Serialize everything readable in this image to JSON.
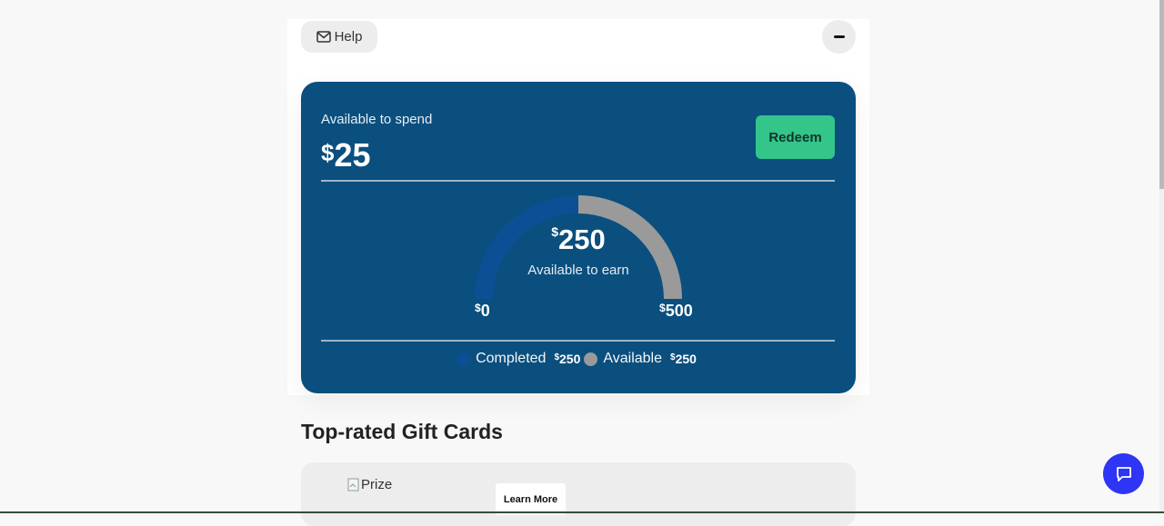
{
  "header": {
    "help_label": "Help",
    "help_icon": "mail-icon",
    "collapse_icon": "minus-icon"
  },
  "rewards": {
    "spend_label": "Available to spend",
    "currency": "$",
    "spend_amount": "25",
    "redeem_label": "Redeem",
    "earn_amount": "250",
    "earn_label": "Available to earn",
    "scale_min": "0",
    "scale_max": "500",
    "completed_fraction": 0.5,
    "legend": [
      {
        "label": "Completed",
        "value": "250",
        "color": "#0d4f94"
      },
      {
        "label": "Available",
        "value": "250",
        "color": "#9a9a9a"
      }
    ]
  },
  "gift_cards": {
    "title": "Top-rated Gift Cards",
    "items": [
      {
        "image_alt": "Prize",
        "learn_more_label": "Learn More"
      }
    ]
  },
  "chat": {
    "icon": "chat-bubble-icon"
  },
  "colors": {
    "card_bg": "#0a4f7e",
    "redeem_bg": "#33c58a",
    "chat_bg": "#2f35f5",
    "gauge_completed": "#0d4f94",
    "gauge_available": "#9a9a9a"
  }
}
